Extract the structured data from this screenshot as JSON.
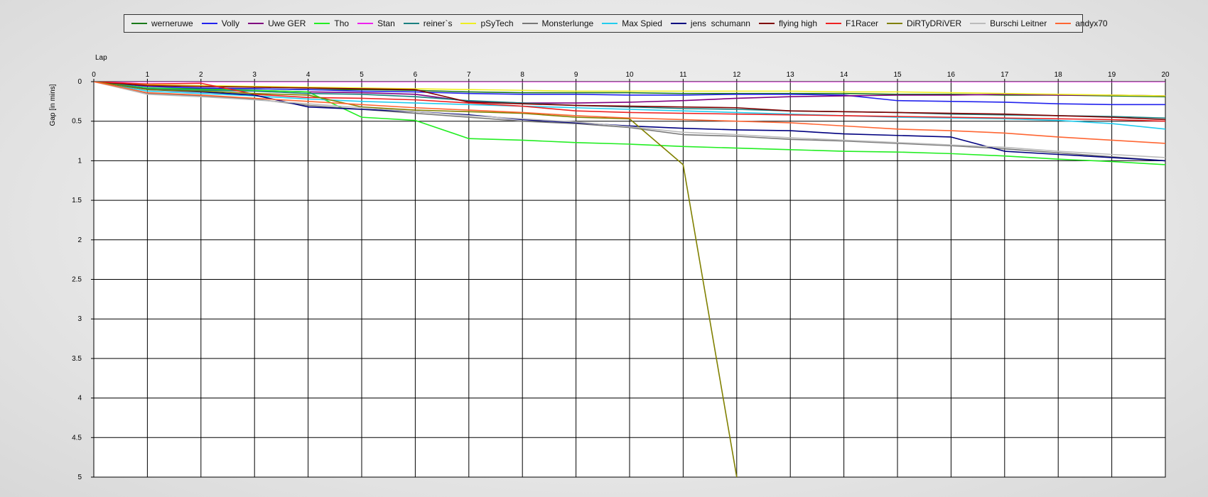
{
  "chart_data": {
    "type": "line",
    "xlabel": "Lap",
    "ylabel": "Gap [in mins]",
    "x": [
      0,
      1,
      2,
      3,
      4,
      5,
      6,
      7,
      8,
      9,
      10,
      11,
      12,
      13,
      14,
      15,
      16,
      17,
      18,
      19,
      20
    ],
    "xlim": [
      0,
      20
    ],
    "ylim": [
      0,
      5
    ],
    "y_inverted": true,
    "x_ticks": [
      "0",
      "1",
      "2",
      "3",
      "4",
      "5",
      "6",
      "7",
      "8",
      "9",
      "10",
      "11",
      "12",
      "13",
      "14",
      "15",
      "16",
      "17",
      "18",
      "19",
      "20"
    ],
    "y_ticks": [
      "0",
      "0.5",
      "1",
      "1.5",
      "2",
      "2.5",
      "3",
      "3.5",
      "4",
      "4.5",
      "5"
    ],
    "grid": true,
    "legend_position": "top",
    "series": [
      {
        "name": "werneruwe",
        "color": "#1a7a1a",
        "values": [
          0,
          0.08,
          0.09,
          0.09,
          0.1,
          0.1,
          0.11,
          0.13,
          0.14,
          0.14,
          0.14,
          0.15,
          0.15,
          0.15,
          0.15,
          0.16,
          0.16,
          0.17,
          0.17,
          0.18,
          0.19
        ]
      },
      {
        "name": "Volly",
        "color": "#2222ee",
        "values": [
          0,
          0.06,
          0.08,
          0.09,
          0.1,
          0.12,
          0.13,
          0.15,
          0.16,
          0.16,
          0.17,
          0.17,
          0.16,
          0.16,
          0.17,
          0.24,
          0.25,
          0.26,
          0.28,
          0.29,
          0.29
        ]
      },
      {
        "name": "Uwe GER",
        "color": "#800080",
        "values": [
          0,
          0.09,
          0.1,
          0.11,
          0.13,
          0.14,
          0.16,
          0.25,
          0.27,
          0.27,
          0.26,
          0.24,
          0.21,
          0.19,
          0.18,
          0.17,
          0.17,
          0.16,
          0.17,
          0.17,
          0.18
        ]
      },
      {
        "name": "Tho",
        "color": "#22ee22",
        "values": [
          0,
          0.08,
          0.1,
          0.11,
          0.13,
          0.45,
          0.49,
          0.72,
          0.74,
          0.77,
          0.79,
          0.82,
          0.84,
          0.86,
          0.88,
          0.89,
          0.91,
          0.94,
          0.98,
          1.01,
          1.05
        ]
      },
      {
        "name": "Stan",
        "color": "#ee22ee",
        "values": [
          0,
          0,
          0,
          0,
          0,
          0,
          0,
          0,
          0,
          0,
          0,
          0,
          0,
          0,
          0,
          0,
          0,
          0,
          0,
          0,
          0
        ]
      },
      {
        "name": "reiner`s",
        "color": "#1a8080",
        "values": [
          0,
          0.09,
          0.11,
          0.12,
          0.15,
          0.16,
          0.19,
          0.24,
          0.27,
          0.3,
          0.32,
          0.34,
          0.35,
          0.37,
          0.38,
          0.39,
          0.41,
          0.42,
          0.43,
          0.44,
          0.46
        ]
      },
      {
        "name": "pSyTech",
        "color": "#eeee22",
        "values": [
          0,
          0.04,
          0.05,
          0.06,
          0.07,
          0.08,
          0.09,
          0.1,
          0.11,
          0.12,
          0.12,
          0.12,
          0.12,
          0.12,
          0.13,
          0.13,
          0.14,
          0.15,
          0.16,
          0.17,
          0.18
        ]
      },
      {
        "name": "Monsterlunge",
        "color": "#777777",
        "values": [
          0,
          0.15,
          0.18,
          0.22,
          0.3,
          0.35,
          0.4,
          0.45,
          0.5,
          0.53,
          0.58,
          0.67,
          0.69,
          0.73,
          0.75,
          0.78,
          0.81,
          0.85,
          0.9,
          0.95,
          1
        ]
      },
      {
        "name": "Max Spied",
        "color": "#22ccee",
        "values": [
          0,
          0.12,
          0.15,
          0.18,
          0.22,
          0.25,
          0.27,
          0.29,
          0.31,
          0.33,
          0.35,
          0.37,
          0.39,
          0.41,
          0.43,
          0.45,
          0.46,
          0.47,
          0.49,
          0.53,
          0.6
        ]
      },
      {
        "name": "jens  schumann",
        "color": "#000080",
        "values": [
          0,
          0.1,
          0.13,
          0.17,
          0.32,
          0.35,
          0.38,
          0.42,
          0.48,
          0.52,
          0.56,
          0.59,
          0.61,
          0.62,
          0.66,
          0.68,
          0.7,
          0.88,
          0.92,
          0.96,
          1
        ]
      },
      {
        "name": "flying high",
        "color": "#800000",
        "values": [
          0,
          0.05,
          0.06,
          0.07,
          0.08,
          0.09,
          0.1,
          0.26,
          0.28,
          0.3,
          0.31,
          0.32,
          0.33,
          0.37,
          0.38,
          0.39,
          0.4,
          0.41,
          0.43,
          0.45,
          0.48
        ]
      },
      {
        "name": "F1Racer",
        "color": "#ee2222",
        "values": [
          0,
          0.03,
          0.02,
          0.16,
          0.2,
          0.21,
          0.23,
          0.27,
          0.31,
          0.37,
          0.39,
          0.4,
          0.41,
          0.42,
          0.43,
          0.44,
          0.45,
          0.46,
          0.47,
          0.48,
          0.5
        ]
      },
      {
        "name": "DiRTyDRiVER",
        "color": "#808000",
        "values": [
          0,
          0.1,
          0.12,
          0.15,
          0.17,
          0.32,
          0.36,
          0.38,
          0.4,
          0.45,
          0.47,
          1.05,
          5
        ]
      },
      {
        "name": "Burschi Leitner",
        "color": "#bbbbbb",
        "values": [
          0,
          0.16,
          0.19,
          0.23,
          0.28,
          0.33,
          0.38,
          0.43,
          0.47,
          0.51,
          0.57,
          0.64,
          0.67,
          0.71,
          0.74,
          0.77,
          0.8,
          0.83,
          0.88,
          0.92,
          0.96
        ]
      },
      {
        "name": "andyx70",
        "color": "#ff6633",
        "values": [
          0,
          0.14,
          0.17,
          0.21,
          0.25,
          0.29,
          0.33,
          0.36,
          0.39,
          0.43,
          0.46,
          0.48,
          0.5,
          0.52,
          0.56,
          0.6,
          0.62,
          0.65,
          0.7,
          0.74,
          0.78
        ]
      }
    ]
  }
}
